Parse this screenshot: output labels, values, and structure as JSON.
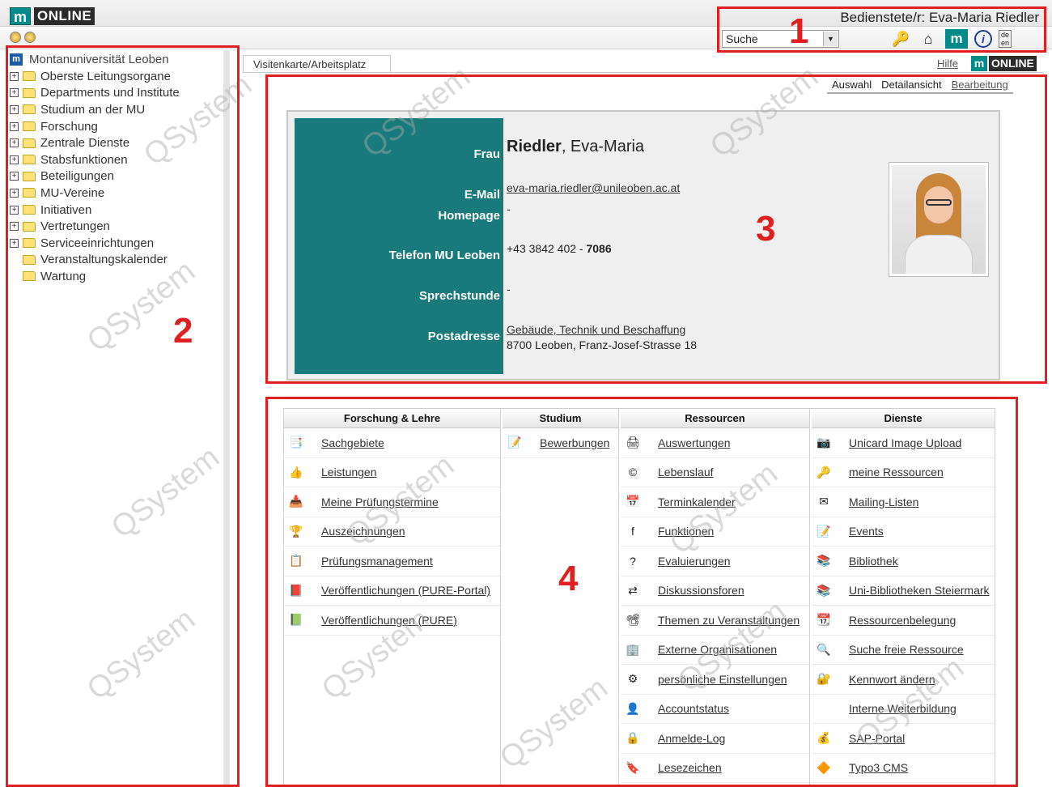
{
  "header": {
    "logo_mark": "m",
    "logo_text": "ONLINE",
    "user_label": "Bedienstete/r: Eva-Maria Riedler",
    "search_value": "Suche",
    "icons": [
      "key-icon",
      "home-icon",
      "tugonline-icon",
      "info-icon",
      "language-icon"
    ],
    "lang_top": "de",
    "lang_bottom": "en"
  },
  "sidebar": {
    "root_label": "Montanuniversität Leoben",
    "items": [
      {
        "label": "Oberste Leitungsorgane",
        "expandable": true
      },
      {
        "label": "Departments und Institute",
        "expandable": true
      },
      {
        "label": "Studium an der MU",
        "expandable": true
      },
      {
        "label": "Forschung",
        "expandable": true
      },
      {
        "label": "Zentrale Dienste",
        "expandable": true
      },
      {
        "label": "Stabsfunktionen",
        "expandable": true
      },
      {
        "label": "Beteiligungen",
        "expandable": true
      },
      {
        "label": "MU-Vereine",
        "expandable": true
      },
      {
        "label": "Initiativen",
        "expandable": true
      },
      {
        "label": "Vertretungen",
        "expandable": true
      },
      {
        "label": "Serviceeinrichtungen",
        "expandable": true
      },
      {
        "label": "Veranstaltungskalender",
        "expandable": false
      },
      {
        "label": "Wartung",
        "expandable": false
      }
    ]
  },
  "main": {
    "tab_label": "Visitenkarte/Arbeitsplatz",
    "help_label": "Hilfe",
    "logo_mark": "m",
    "logo_text": "ONLINE",
    "view_tabs": {
      "auswahl": "Auswahl",
      "detail": "Detailansicht",
      "edit": "Bearbeitung"
    }
  },
  "card": {
    "salutation": "Frau",
    "last_name": "Riedler",
    "first_name": ", Eva-Maria",
    "email_label": "E-Mail",
    "email": "eva-maria.riedler@unileoben.ac.at",
    "homepage_label": "Homepage",
    "homepage": "-",
    "phone_label": "Telefon  MU Leoben",
    "phone_prefix": "+43 3842 402 - ",
    "phone_ext": "7086",
    "office_hours_label": "Sprechstunde",
    "office_hours": "-",
    "address_label": "Postadresse",
    "address_link": "Gebäude, Technik und Beschaffung",
    "address_line": "8700 Leoben, Franz-Josef-Strasse 18"
  },
  "services": {
    "forschung": {
      "title": "Forschung & Lehre",
      "items": [
        {
          "label": "Sachgebiete",
          "icon": "📑"
        },
        {
          "label": "Leistungen",
          "icon": "👍"
        },
        {
          "label": "Meine Prüfungstermine",
          "icon": "📥"
        },
        {
          "label": "Auszeichnungen",
          "icon": "🏆"
        },
        {
          "label": "Prüfungsmanagement",
          "icon": "📋"
        },
        {
          "label": "Veröffentlichungen (PURE-Portal)",
          "icon": "📕"
        },
        {
          "label": "Veröffentlichungen (PURE)",
          "icon": "📗"
        }
      ]
    },
    "studium": {
      "title": "Studium",
      "items": [
        {
          "label": "Bewerbungen",
          "icon": "📝"
        }
      ]
    },
    "ressourcen": {
      "title": "Ressourcen",
      "items": [
        {
          "label": "Auswertungen",
          "icon": "🖨"
        },
        {
          "label": "Lebenslauf",
          "icon": "©"
        },
        {
          "label": "Terminkalender",
          "icon": "📅"
        },
        {
          "label": "Funktionen",
          "icon": "f"
        },
        {
          "label": "Evaluierungen",
          "icon": "?"
        },
        {
          "label": "Diskussionsforen",
          "icon": "⇄"
        },
        {
          "label": "Themen zu Veranstaltungen",
          "icon": "📽"
        },
        {
          "label": "Externe Organisationen",
          "icon": "🏢"
        },
        {
          "label": "persönliche Einstellungen",
          "icon": "⚙"
        },
        {
          "label": "Accountstatus",
          "icon": "👤"
        },
        {
          "label": "Anmelde-Log",
          "icon": "🔒"
        },
        {
          "label": "Lesezeichen",
          "icon": "🔖"
        }
      ]
    },
    "dienste": {
      "title": "Dienste",
      "items": [
        {
          "label": "Unicard Image Upload",
          "icon": "📷"
        },
        {
          "label": "meine Ressourcen",
          "icon": "🔑"
        },
        {
          "label": "Mailing-Listen",
          "icon": "✉"
        },
        {
          "label": "Events",
          "icon": "📝"
        },
        {
          "label": "Bibliothek",
          "icon": "📚"
        },
        {
          "label": "Uni-Bibliotheken Steiermark",
          "icon": "📚"
        },
        {
          "label": "Ressourcenbelegung",
          "icon": "📆"
        },
        {
          "label": "Suche freie Ressource",
          "icon": "🔍"
        },
        {
          "label": "Kennwort ändern",
          "icon": "🔐"
        },
        {
          "label": "Interne Weiterbildung",
          "icon": ""
        },
        {
          "label": "SAP-Portal",
          "icon": "💰"
        },
        {
          "label": "Typo3 CMS",
          "icon": "🔶"
        }
      ]
    }
  },
  "watermark": "QSystem",
  "annotations": {
    "n1": "1",
    "n2": "2",
    "n3": "3",
    "n4": "4"
  },
  "colors": {
    "teal": "#187a7a",
    "annotation_red": "#e02020",
    "brand_teal": "#008b8b"
  }
}
